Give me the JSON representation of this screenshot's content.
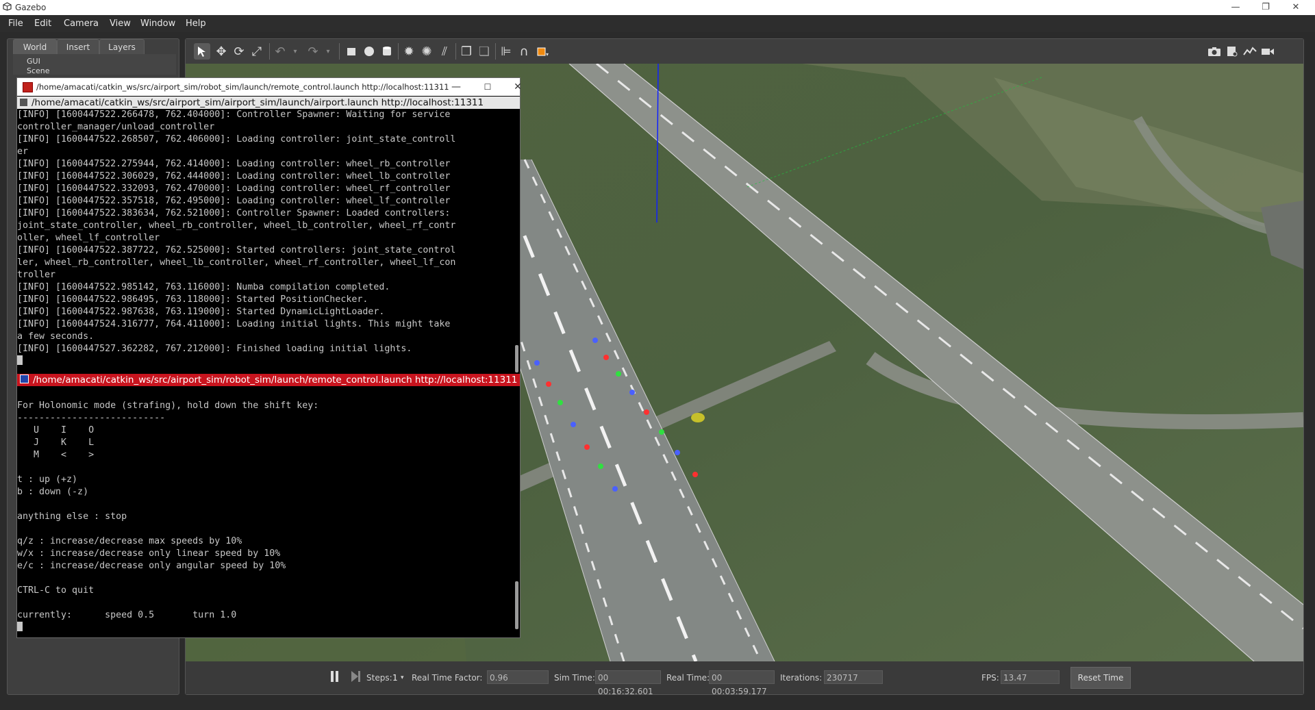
{
  "app": {
    "title": "Gazebo"
  },
  "menubar": {
    "items": [
      "File",
      "Edit",
      "Camera",
      "View",
      "Window",
      "Help"
    ]
  },
  "left_panel": {
    "tabs": [
      "World",
      "Insert",
      "Layers"
    ],
    "tree": [
      "GUI",
      "Scene"
    ]
  },
  "toolbar": {
    "left_icons": [
      "select-arrow-icon",
      "translate-icon",
      "rotate-icon",
      "scale-icon",
      "undo-icon",
      "undo-dropdown-icon",
      "redo-icon",
      "redo-dropdown-icon",
      "box-icon",
      "sphere-icon",
      "cylinder-icon",
      "point-light-icon",
      "spot-light-icon",
      "directional-light-icon",
      "copy-icon",
      "paste-icon",
      "align-icon",
      "snap-icon",
      "view-angle-icon"
    ],
    "right_icons": [
      "screenshot-icon",
      "log-icon",
      "plot-icon",
      "video-record-icon"
    ]
  },
  "bottom_bar": {
    "steps_label": "Steps:",
    "steps_value": "1",
    "rtf_label": "Real Time Factor:",
    "rtf_value": "0.96",
    "sim_time_label": "Sim Time:",
    "sim_time_value": "00 00:16:32.601",
    "real_time_label": "Real Time:",
    "real_time_value": "00 00:03:59.177",
    "iterations_label": "Iterations:",
    "iterations_value": "230717",
    "fps_label": "FPS:",
    "fps_value": "13.47",
    "reset_label": "Reset Time"
  },
  "terminal": {
    "window_title": "/home/amacati/catkin_ws/src/airport_sim/robot_sim/launch/remote_control.launch http://localhost:11311",
    "pane1_title": "/home/amacati/catkin_ws/src/airport_sim/airport_sim/launch/airport.launch http://localhost:11311",
    "pane1_lines": [
      "[INFO] [1600447522.266478, 762.404000]: Controller Spawner: Waiting for service",
      "controller_manager/unload_controller",
      "[INFO] [1600447522.268507, 762.406000]: Loading controller: joint_state_controll",
      "er",
      "[INFO] [1600447522.275944, 762.414000]: Loading controller: wheel_rb_controller",
      "[INFO] [1600447522.306029, 762.444000]: Loading controller: wheel_lb_controller",
      "[INFO] [1600447522.332093, 762.470000]: Loading controller: wheel_rf_controller",
      "[INFO] [1600447522.357518, 762.495000]: Loading controller: wheel_lf_controller",
      "[INFO] [1600447522.383634, 762.521000]: Controller Spawner: Loaded controllers:",
      "joint_state_controller, wheel_rb_controller, wheel_lb_controller, wheel_rf_contr",
      "oller, wheel_lf_controller",
      "[INFO] [1600447522.387722, 762.525000]: Started controllers: joint_state_control",
      "ler, wheel_rb_controller, wheel_lb_controller, wheel_rf_controller, wheel_lf_con",
      "troller",
      "[INFO] [1600447522.985142, 763.116000]: Numba compilation completed.",
      "[INFO] [1600447522.986495, 763.118000]: Started PositionChecker.",
      "[INFO] [1600447522.987638, 763.119000]: Started DynamicLightLoader.",
      "[INFO] [1600447524.316777, 764.411000]: Loading initial lights. This might take",
      "a few seconds.",
      "[INFO] [1600447527.362282, 767.212000]: Finished loading initial lights."
    ],
    "pane2_title": "/home/amacati/catkin_ws/src/airport_sim/robot_sim/launch/remote_control.launch http://localhost:11311",
    "pane2_lines": [
      "",
      "For Holonomic mode (strafing), hold down the shift key:",
      "---------------------------",
      "   U    I    O",
      "   J    K    L",
      "   M    <    >",
      "",
      "t : up (+z)",
      "b : down (-z)",
      "",
      "anything else : stop",
      "",
      "q/z : increase/decrease max speeds by 10%",
      "w/x : increase/decrease only linear speed by 10%",
      "e/c : increase/decrease only angular speed by 10%",
      "",
      "CTRL-C to quit",
      "",
      "currently:      speed 0.5       turn 1.0"
    ]
  },
  "colors": {
    "terminal_bg": "#000000",
    "terminal_fg": "#c8c8c8",
    "pane2_title_bg": "#c8141e",
    "gazebo_dark": "#3a3a3a"
  }
}
